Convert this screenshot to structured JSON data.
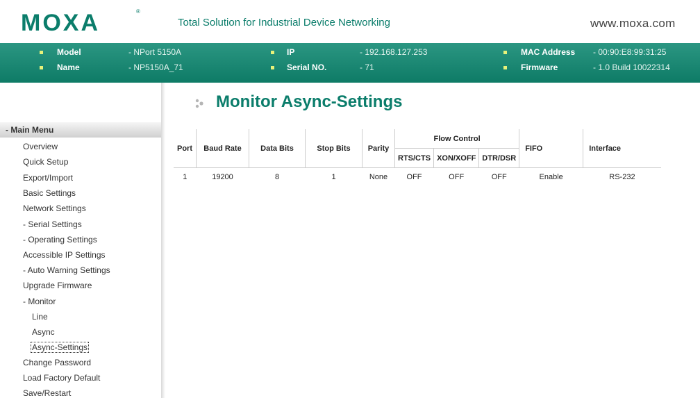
{
  "header": {
    "logo_text": "MOXA",
    "logo_mark": "®",
    "slogan": "Total Solution for Industrial Device Networking",
    "website": "www.moxa.com"
  },
  "info": {
    "model_label": "Model",
    "model_value": "- NPort 5150A",
    "name_label": "Name",
    "name_value": "- NP5150A_71",
    "ip_label": "IP",
    "ip_value": "- 192.168.127.253",
    "serial_label": "Serial NO.",
    "serial_value": "- 71",
    "mac_label": "MAC Address",
    "mac_value": "- 00:90:E8:99:31:25",
    "firmware_label": "Firmware",
    "firmware_value": "- 1.0 Build 10022314"
  },
  "sidebar": {
    "header": "- Main Menu",
    "items": [
      "Overview",
      "Quick Setup",
      "Export/Import",
      "Basic Settings",
      "Network Settings",
      "- Serial Settings",
      "- Operating Settings",
      "Accessible IP Settings",
      "- Auto Warning Settings",
      "Upgrade Firmware",
      "- Monitor",
      "Line",
      "Async",
      "Async-Settings",
      "Change Password",
      "Load Factory Default",
      "Save/Restart"
    ]
  },
  "main": {
    "title": "Monitor Async-Settings",
    "table": {
      "headers": {
        "port": "Port",
        "baud_rate": "Baud Rate",
        "data_bits": "Data Bits",
        "stop_bits": "Stop Bits",
        "parity": "Parity",
        "flow_control": "Flow Control",
        "rts_cts": "RTS/CTS",
        "xon_xoff": "XON/XOFF",
        "dtr_dsr": "DTR/DSR",
        "fifo": "FIFO",
        "interface": "Interface"
      },
      "rows": [
        [
          "1",
          "19200",
          "8",
          "1",
          "None",
          "OFF",
          "OFF",
          "OFF",
          "Enable",
          "RS-232"
        ]
      ]
    }
  },
  "colors": {
    "brand": "#0b7d6b",
    "bar": "#1a8a74",
    "bullet": "#e8f27a"
  }
}
